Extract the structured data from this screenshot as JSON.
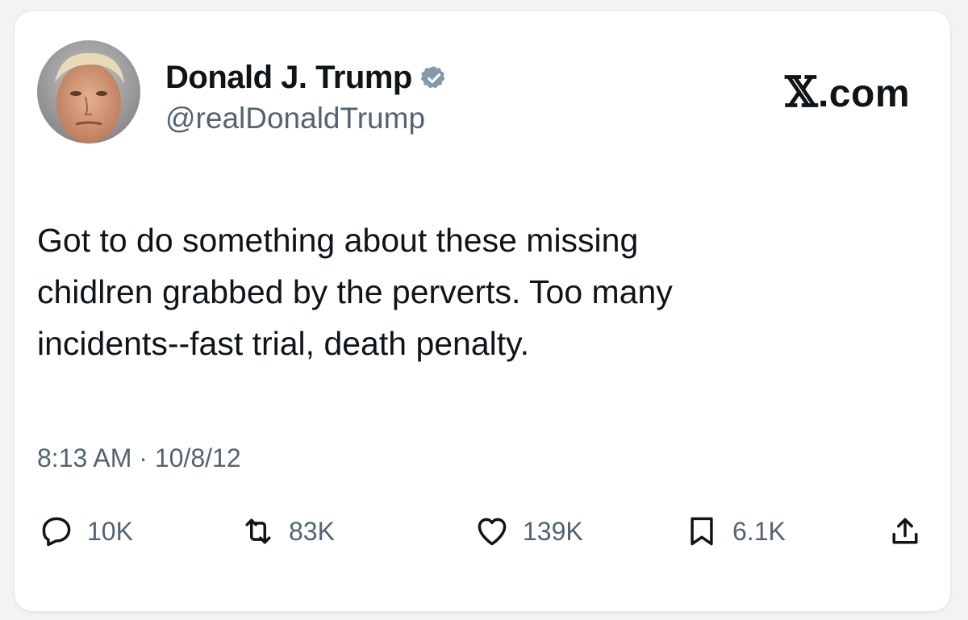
{
  "author": {
    "display_name": "Donald J. Trump",
    "handle": "@realDonaldTrump",
    "avatar_icon": "avatar-photo",
    "verified_icon": "verified-badge-icon",
    "verified_color": "#829aab"
  },
  "site": {
    "x_glyph": "𝕏",
    "suffix": ".com"
  },
  "tweet": {
    "lines": [
      "Got to do something about these missing",
      "chidlren grabbed by the perverts. Too many",
      "incidents--fast trial, death penalty."
    ],
    "timestamp": "8:13 AM · 10/8/12"
  },
  "actions": {
    "replies": {
      "icon": "reply-icon",
      "count": "10K"
    },
    "reposts": {
      "icon": "repost-icon",
      "count": "83K"
    },
    "likes": {
      "icon": "heart-icon",
      "count": "139K"
    },
    "bookmarks": {
      "icon": "bookmark-icon",
      "count": "6.1K"
    },
    "share": {
      "icon": "share-icon"
    }
  },
  "colors": {
    "text_primary": "#0f1419",
    "text_secondary": "#536471"
  }
}
